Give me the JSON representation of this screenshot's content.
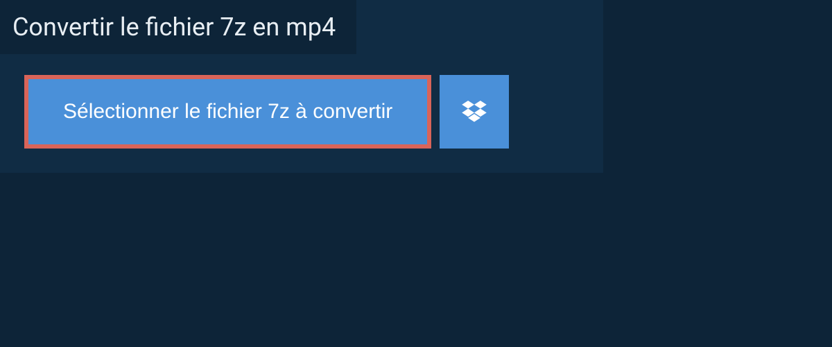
{
  "header": {
    "title": "Convertir le fichier 7z en mp4"
  },
  "actions": {
    "select_file_label": "Sélectionner le fichier 7z à convertir"
  },
  "colors": {
    "page_bg": "#0d2438",
    "panel_bg": "#102c44",
    "button_bg": "#4a90d9",
    "highlight_border": "#d96459",
    "text_light": "#e8eef3"
  }
}
